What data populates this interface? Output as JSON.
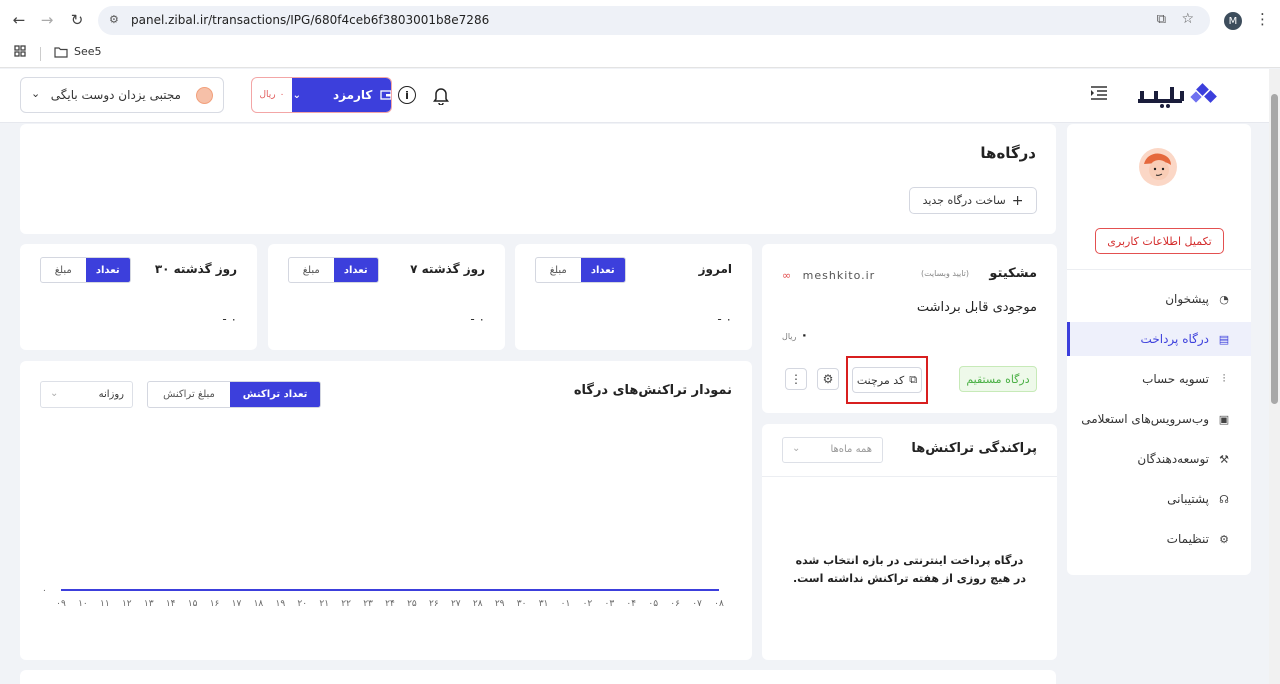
{
  "browser": {
    "url": "panel.zibal.ir/transactions/IPG/680f4ceb6f3803001b8e7286",
    "profile_initial": "M",
    "bookmark_folder": "See5"
  },
  "header": {
    "user_name": "مجتبی یزدان دوست بایگی",
    "karmozd_label": "کارمزد",
    "karmozd_value": "۰",
    "karmozd_unit": "ریال"
  },
  "brand": {
    "accent": "#3c3fdc",
    "danger": "#d81f1f",
    "success": "#4bb046"
  },
  "sidebar": {
    "complete_profile": "تکمیل اطلاعات کاربری",
    "items": [
      {
        "label": "پیشخوان",
        "icon": "dashboard-icon"
      },
      {
        "label": "درگاه پرداخت",
        "icon": "gateway-icon",
        "active": true
      },
      {
        "label": "تسویه حساب",
        "icon": "settlement-icon"
      },
      {
        "label": "وب‌سرویس‌های استعلامی",
        "icon": "webservice-icon"
      },
      {
        "label": "توسعه‌دهندگان",
        "icon": "developer-icon"
      },
      {
        "label": "پشتیبانی",
        "icon": "headset-icon"
      },
      {
        "label": "تنظیمات",
        "icon": "gear-icon"
      }
    ]
  },
  "page": {
    "title": "درگاه‌ها",
    "new_gateway_button": "ساخت درگاه جدید"
  },
  "stats": [
    {
      "title": "امروز",
      "toggle_on": "تعداد",
      "toggle_off": "مبلغ",
      "value": "- ۰"
    },
    {
      "title": "۷ روز گذشته",
      "toggle_on": "تعداد",
      "toggle_off": "مبلغ",
      "value": "- ۰"
    },
    {
      "title": "۳۰ روز گذشته",
      "toggle_on": "تعداد",
      "toggle_off": "مبلغ",
      "value": "- ۰"
    }
  ],
  "merchant": {
    "name": "مشکیتو",
    "verify_status": "(تایید وبسایت)",
    "website": "meshkito.ir",
    "balance_label": "موجودی قابل برداشت",
    "balance": "۰",
    "balance_unit": "ریال",
    "type_badge": "درگاه مستقیم",
    "merchant_code_button": "کد مرچنت"
  },
  "distribution": {
    "title": "پراکندگی تراکنش‌ها",
    "select_placeholder": "همه ماه‌ها",
    "empty_message": "درگاه پرداخت اینترنتی در بازه انتخاب شده در هیچ روزی از هفته تراکنش نداشته است."
  },
  "chart_section": {
    "title": "نمودار تراکنش‌های درگاه",
    "toggle_on": "تعداد تراکنش",
    "toggle_off": "مبلغ تراکنش",
    "period": "روزانه"
  },
  "chart_data": {
    "type": "line",
    "x": [
      "۰۹",
      "۱۰",
      "۱۱",
      "۱۲",
      "۱۳",
      "۱۴",
      "۱۵",
      "۱۶",
      "۱۷",
      "۱۸",
      "۱۹",
      "۲۰",
      "۲۱",
      "۲۲",
      "۲۳",
      "۲۴",
      "۲۵",
      "۲۶",
      "۲۷",
      "۲۸",
      "۲۹",
      "۳۰",
      "۳۱",
      "۰۱",
      "۰۲",
      "۰۳",
      "۰۴",
      "۰۵",
      "۰۶",
      "۰۷",
      "۰۸"
    ],
    "series": [
      {
        "values": [
          0,
          0,
          0,
          0,
          0,
          0,
          0,
          0,
          0,
          0,
          0,
          0,
          0,
          0,
          0,
          0,
          0,
          0,
          0,
          0,
          0,
          0,
          0,
          0,
          0,
          0,
          0,
          0,
          0,
          0,
          0
        ],
        "color": "#3c3fdc"
      }
    ],
    "y_ticks": [
      "۰"
    ],
    "ylim": [
      0,
      1
    ]
  }
}
